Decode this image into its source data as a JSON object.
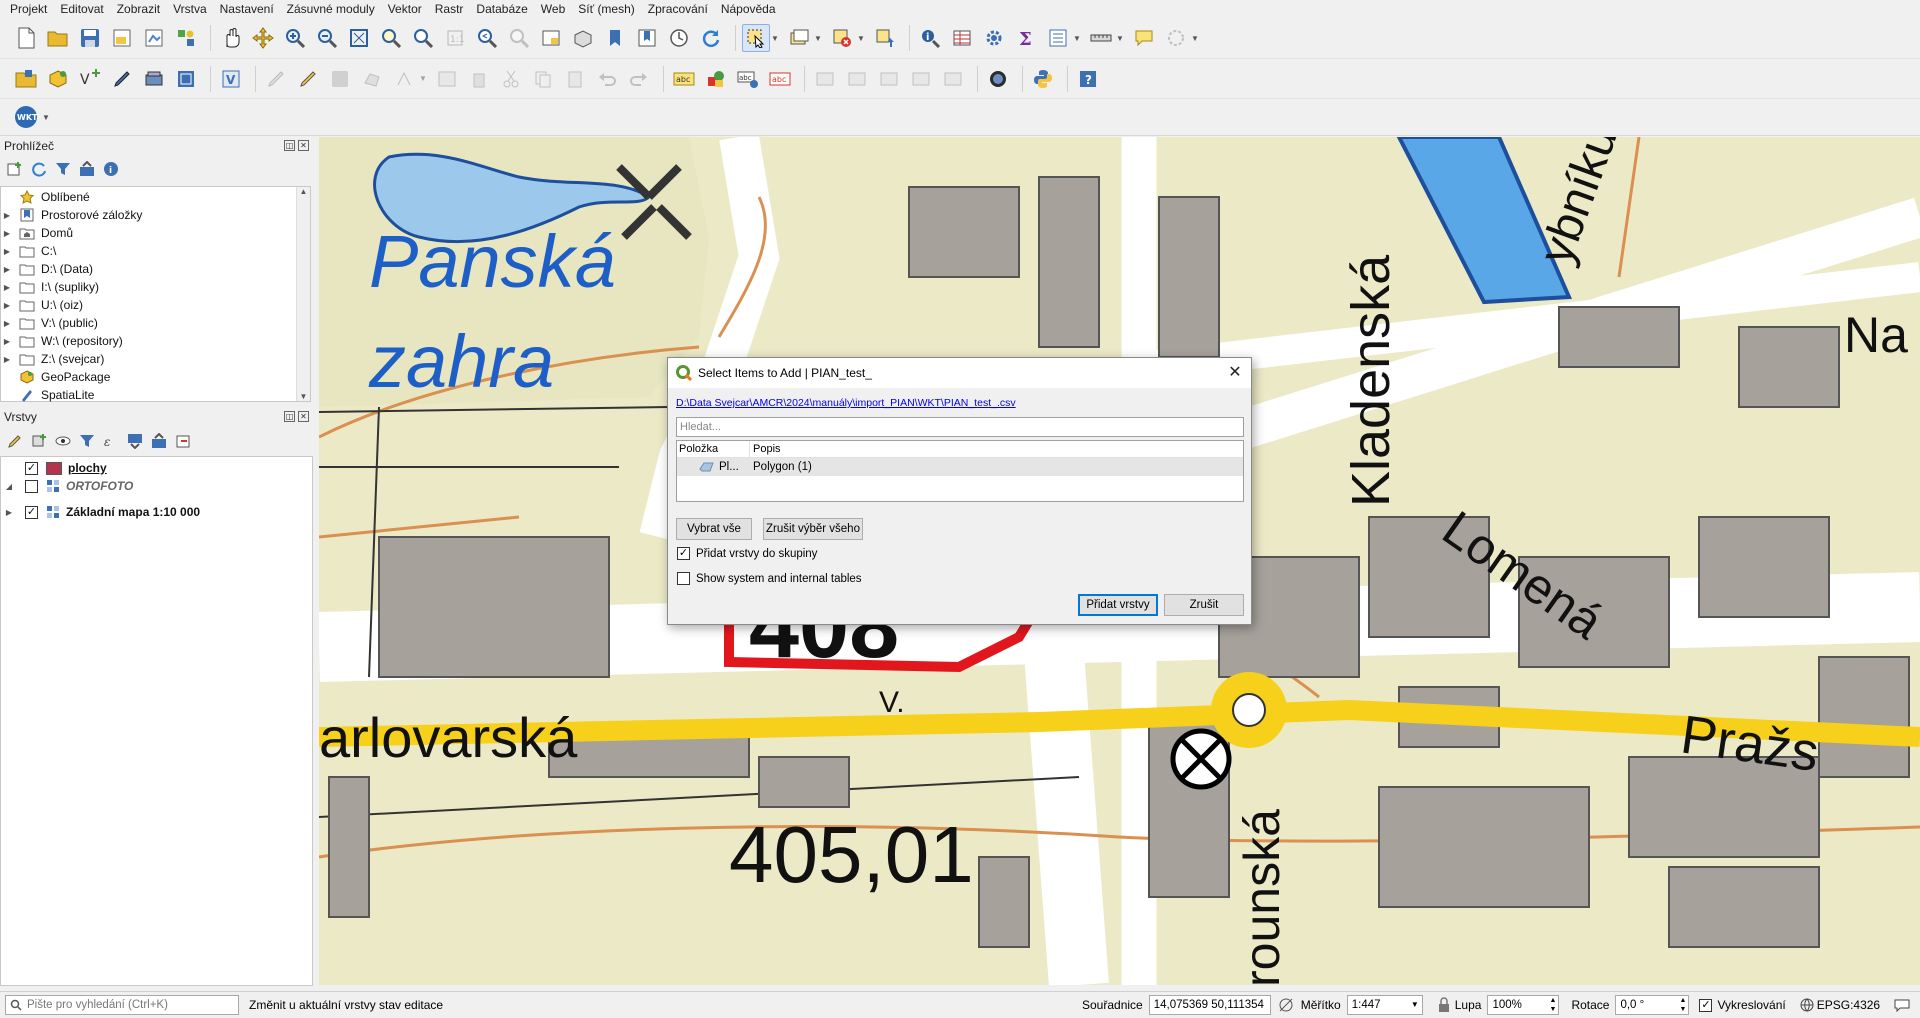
{
  "menu": [
    "Projekt",
    "Editovat",
    "Zobrazit",
    "Vrstva",
    "Nastavení",
    "Zásuvné moduly",
    "Vektor",
    "Rastr",
    "Databáze",
    "Web",
    "Síť (mesh)",
    "Zpracování",
    "Nápověda"
  ],
  "toolbar3": {
    "wkt_label": "WKT"
  },
  "browser": {
    "title": "Prohlížeč",
    "items": [
      {
        "label": "Oblíbené",
        "icon": "star-icon"
      },
      {
        "label": "Prostorové záložky",
        "icon": "bookmark-icon"
      },
      {
        "label": "Domů",
        "icon": "home-folder-icon"
      },
      {
        "label": "C:\\",
        "icon": "folder-icon"
      },
      {
        "label": "D:\\ (Data)",
        "icon": "folder-icon"
      },
      {
        "label": "I:\\ (supliky)",
        "icon": "folder-icon"
      },
      {
        "label": "U:\\ (oiz)",
        "icon": "folder-icon"
      },
      {
        "label": "V:\\ (public)",
        "icon": "folder-icon"
      },
      {
        "label": "W:\\ (repository)",
        "icon": "folder-icon"
      },
      {
        "label": "Z:\\ (svejcar)",
        "icon": "folder-icon"
      },
      {
        "label": "GeoPackage",
        "icon": "geopackage-icon"
      },
      {
        "label": "SpatiaLite",
        "icon": "spatialite-icon"
      }
    ]
  },
  "layers": {
    "title": "Vrstvy",
    "items": [
      {
        "label": "plochy",
        "checked": true,
        "style": "bold-underline",
        "color": "#b5344d"
      },
      {
        "label": "ORTOFOTO",
        "checked": false,
        "style": "italic"
      },
      {
        "label": "Základní mapa 1:10 000",
        "checked": true,
        "style": "bold"
      }
    ]
  },
  "map_labels": {
    "panska": "Panská",
    "zahra": "zahra",
    "kladenska": "Kladenská",
    "lomena": "Lomená",
    "karlovarska": "arlovarská",
    "prazska": "Pražs",
    "rounska": "rounská",
    "ybniku": "ybníku",
    "na": "Na",
    "elev_408": "408",
    "elev_405": "405,01",
    "v": "V."
  },
  "dialog": {
    "title": "Select Items to Add | PIAN_test_",
    "path": "D:\\Data Svejcar\\AMCR\\2024\\manuály\\import_PIAN\\WKT\\PIAN_test_.csv",
    "search_placeholder": "Hledat...",
    "col_item": "Položka",
    "col_desc": "Popis",
    "row_item": "Pl...",
    "row_desc": "Polygon (1)",
    "select_all": "Vybrat vše",
    "deselect_all": "Zrušit výběr všeho",
    "add_to_group": "Přidat vrstvy do skupiny",
    "add_to_group_checked": true,
    "show_system": "Show system and internal tables",
    "show_system_checked": false,
    "add_layers": "Přidat vrstvy",
    "cancel": "Zrušit"
  },
  "status": {
    "search_placeholder": "Pište pro vyhledání (Ctrl+K)",
    "message": "Změnit u aktuální vrstvy stav editace",
    "coord_label": "Souřadnice",
    "coord_value": "14,075369 50,111354",
    "scale_label": "Měřítko",
    "scale_value": "1:447",
    "magnifier_label": "Lupa",
    "magnifier_value": "100%",
    "rotation_label": "Rotace",
    "rotation_value": "0,0 °",
    "render_label": "Vykreslování",
    "render_checked": true,
    "crs": "EPSG:4326"
  }
}
